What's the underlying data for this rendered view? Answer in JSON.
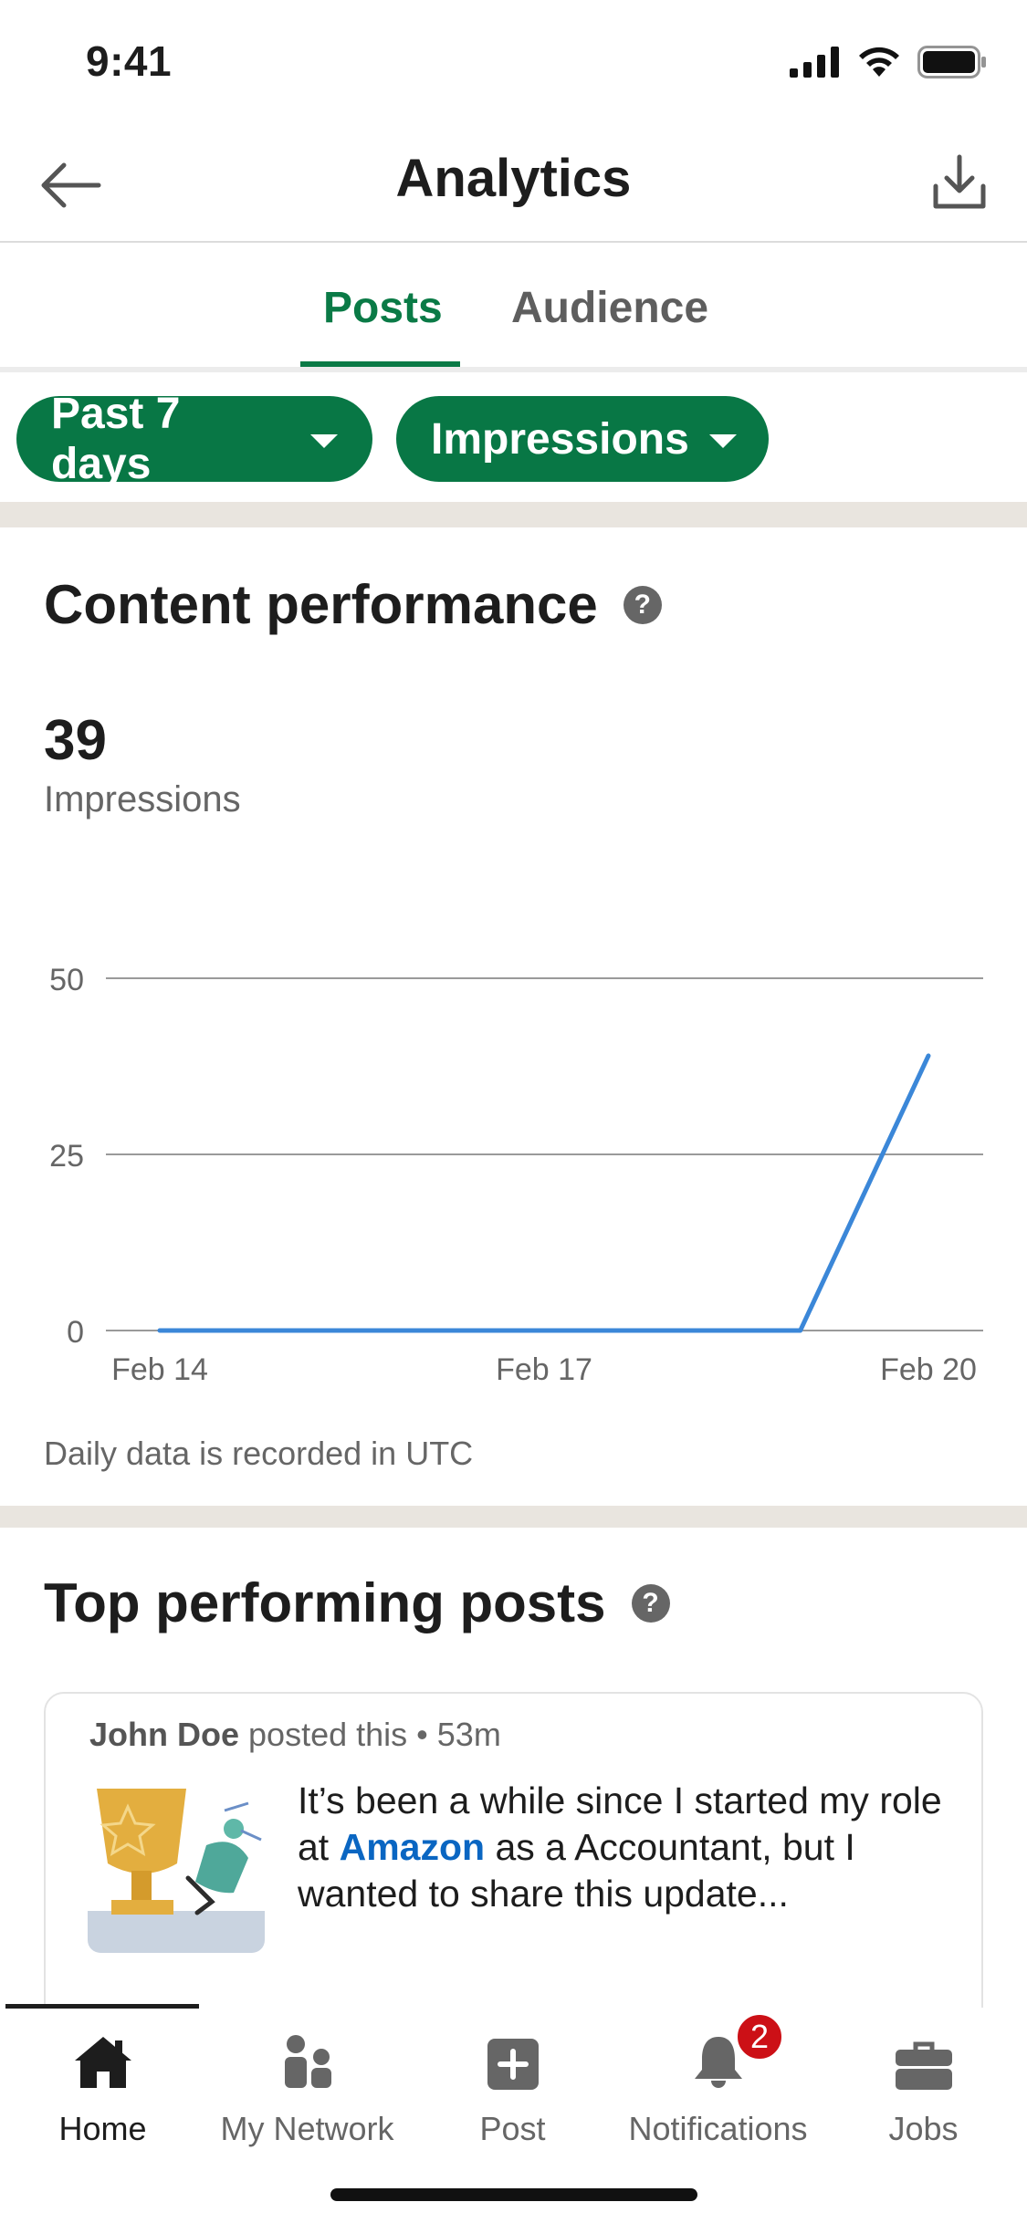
{
  "status": {
    "time": "9:41"
  },
  "header": {
    "title": "Analytics"
  },
  "tabs": [
    {
      "label": "Posts",
      "active": true
    },
    {
      "label": "Audience",
      "active": false
    }
  ],
  "filters": {
    "range": "Past 7 days",
    "metric": "Impressions"
  },
  "performance": {
    "title": "Content performance",
    "help": "?",
    "total": "39",
    "metric_label": "Impressions",
    "note": "Daily data is recorded in UTC"
  },
  "chart_data": {
    "type": "line",
    "x": [
      "Feb 14",
      "Feb 15",
      "Feb 16",
      "Feb 17",
      "Feb 18",
      "Feb 19",
      "Feb 20"
    ],
    "x_tick_labels": [
      "Feb 14",
      "Feb 17",
      "Feb 20"
    ],
    "series": [
      {
        "values": [
          0,
          0,
          0,
          0,
          0,
          0,
          39
        ],
        "color": "#3b87d8"
      }
    ],
    "ylim": [
      0,
      50
    ],
    "yticks": [
      "50",
      "25",
      "0"
    ],
    "grid": true
  },
  "top_posts": {
    "title": "Top performing posts",
    "help": "?",
    "items": [
      {
        "author": "John Doe",
        "action": "posted this",
        "time": "• 53m",
        "text_before": "It’s been a while since I started my role at ",
        "link_text": "Amazon",
        "text_after": " as a Accountant, but I wanted to share this update..."
      }
    ]
  },
  "bottom_nav": [
    {
      "label": "Home",
      "icon": "home-icon",
      "active": true
    },
    {
      "label": "My Network",
      "icon": "network-icon"
    },
    {
      "label": "Post",
      "icon": "plus-square-icon"
    },
    {
      "label": "Notifications",
      "icon": "bell-icon",
      "badge": "2"
    },
    {
      "label": "Jobs",
      "icon": "briefcase-icon"
    }
  ],
  "colors": {
    "brand_green": "#087745",
    "tab_green": "#0a7a46",
    "line_blue": "#3b87d8",
    "badge_red": "#cc1016"
  }
}
